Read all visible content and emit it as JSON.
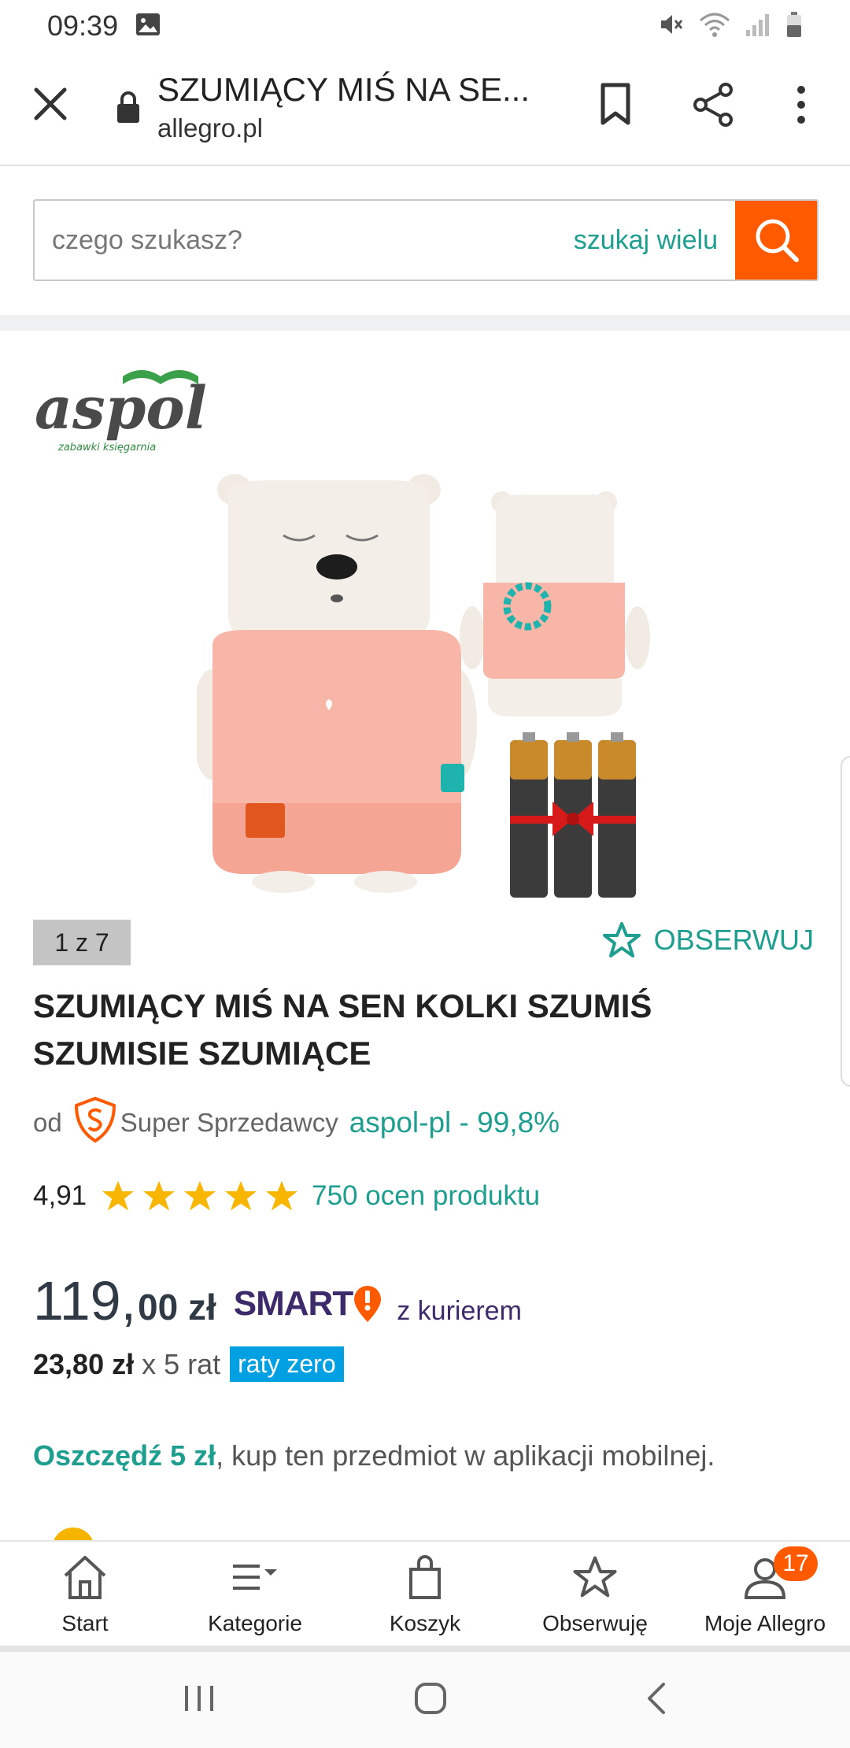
{
  "status_bar": {
    "time": "09:39"
  },
  "browser": {
    "page_title": "SZUMIĄCY MIŚ NA SE...",
    "domain": "allegro.pl"
  },
  "search": {
    "placeholder": "czego szukasz?",
    "multi_search_label": "szukaj wielu"
  },
  "gallery": {
    "counter": "1 z 7"
  },
  "product": {
    "watch_label": "OBSERWUJ",
    "title": "SZUMIĄCY MIŚ NA SEN KOLKI SZUMIŚ SZUMISIE SZUMIĄCE",
    "seller": {
      "prefix": "od",
      "badge_label": "Super Sprzedawcy",
      "name_rating": "aspol-pl - 99,8%"
    },
    "rating": {
      "value": "4,91",
      "stars": 5,
      "count_label": "750 ocen produktu"
    },
    "price": {
      "integer": "119,",
      "decimal": "00 zł",
      "smart": "SMART",
      "courier": "z kurierem"
    },
    "installments": {
      "amount": "23,80 zł",
      "times": "x 5 rat",
      "badge": "raty zero"
    },
    "savings": {
      "strong": "Oszczędź 5 zł",
      "rest": ", kup ten przedmiot w aplikacji mobilnej."
    }
  },
  "bottom_nav": {
    "items": [
      {
        "label": "Start"
      },
      {
        "label": "Kategorie"
      },
      {
        "label": "Koszyk"
      },
      {
        "label": "Obserwuję"
      },
      {
        "label": "Moje Allegro",
        "badge": "17"
      }
    ]
  },
  "colors": {
    "accent_teal": "#1d9e8e",
    "accent_orange": "#ff5a00",
    "smart_purple": "#3d2a6b",
    "raty_blue": "#00a0e3"
  }
}
